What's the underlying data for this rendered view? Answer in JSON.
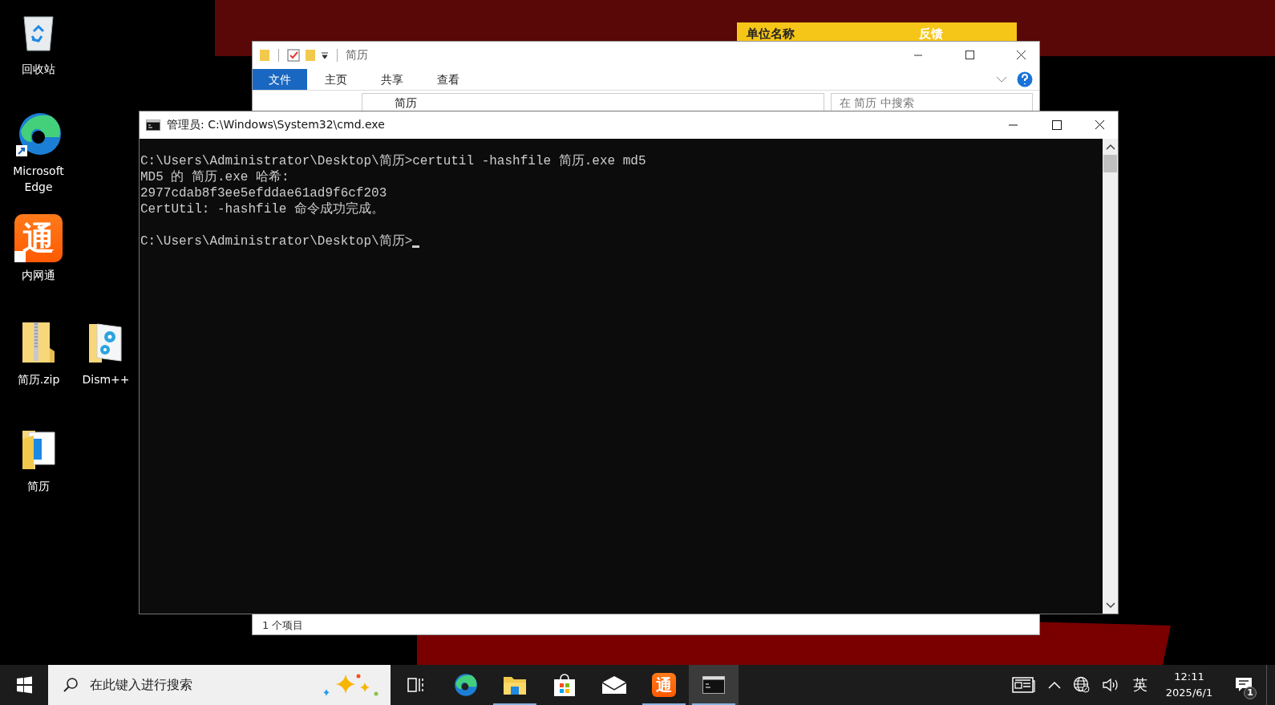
{
  "desktop_icons": [
    {
      "kind": "recycle",
      "label": "回收站"
    },
    {
      "kind": "edge",
      "label": "Microsoft Edge",
      "shortcut": true
    },
    {
      "kind": "tong",
      "label": "内网通",
      "logo_text": "通",
      "shortcut": true
    },
    {
      "kind": "zip",
      "label": "简历.zip"
    },
    {
      "kind": "folder",
      "label": "简历"
    },
    {
      "kind": "dism",
      "label": "Dism++"
    }
  ],
  "notice_widget": {
    "title": "单位名称",
    "link": "反馈"
  },
  "explorer": {
    "title": "简历",
    "tabs": [
      {
        "label": "文件",
        "selected": true
      },
      {
        "label": "主页",
        "selected": false
      },
      {
        "label": "共享",
        "selected": false
      },
      {
        "label": "查看",
        "selected": false
      }
    ],
    "address": "简历",
    "search": {
      "placeholder": "在 简历 中搜索"
    },
    "status_bar": "1 个项目"
  },
  "cmd": {
    "title": "管理员: C:\\Windows\\System32\\cmd.exe",
    "lines": [
      "C:\\Users\\Administrator\\Desktop\\简历>certutil -hashfile 简历.exe md5",
      "MD5 的 简历.exe 哈希:",
      "2977cdab8f3ee5efddae61ad9f6cf203",
      "CertUtil: -hashfile 命令成功完成。",
      "C:\\Users\\Administrator\\Desktop\\简历>"
    ],
    "blank_before_last": true,
    "cursor": true
  },
  "taskbar": {
    "search": {
      "placeholder": "在此键入进行搜索"
    },
    "apps": [
      {
        "kind": "taskview",
        "running": false,
        "active": false
      },
      {
        "kind": "edge",
        "running": false,
        "active": false
      },
      {
        "kind": "explorer",
        "running": true,
        "active": false
      },
      {
        "kind": "store",
        "running": false,
        "active": false
      },
      {
        "kind": "mail",
        "running": false,
        "active": false
      },
      {
        "kind": "tong",
        "logo_text": "通",
        "running": true,
        "active": false
      },
      {
        "kind": "cmd",
        "running": true,
        "active": true
      }
    ],
    "ime": "英",
    "time": "12:11",
    "date": "2025/6/1",
    "notification_count": "1"
  }
}
